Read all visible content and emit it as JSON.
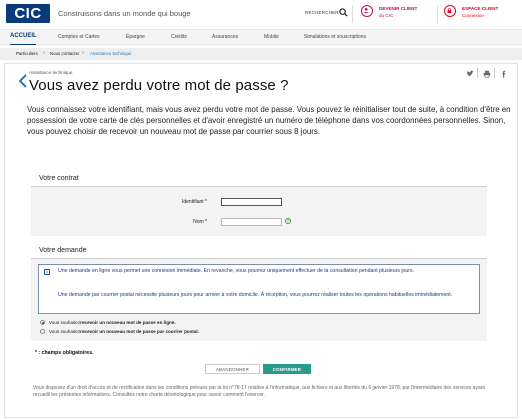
{
  "header": {
    "logo_text": "CIC",
    "tagline": "Construisons dans un monde qui bouge",
    "search_label": "RECHERCHER",
    "devenir_client": {
      "line1": "DEVENIR CLIENT",
      "line2": "du CIC"
    },
    "espace_client": {
      "line1": "ESPACE CLIENT",
      "line2": "Connexion"
    }
  },
  "nav": {
    "items": [
      "ACCUEIL",
      "Comptes et Cartes",
      "Épargne",
      "Crédits",
      "Assurances",
      "Mobile",
      "Simulations et souscriptions"
    ]
  },
  "breadcrumb": [
    "Particuliers",
    "Nous contacter",
    "Assistance technique"
  ],
  "page": {
    "kicker": "Assistance technique",
    "title": "Vous avez perdu votre mot de passe ?",
    "intro": "Vous connaissez votre identifiant, mais vous avez perdu votre mot de passe. Vous pouvez le réinitialiser tout de suite, à condition d'être en possession de votre carte de clés personnelles et d'avoir enregistré un numéro de téléphone dans vos coordonnées personnelles. Sinon, vous pouvez choisir de recevoir un nouveau mot de passe par courrier sous 8 jours."
  },
  "form": {
    "contrat_title": "Votre contrat",
    "identifiant_label": "Identifiant *",
    "identifiant_value": "",
    "nom_label": "Nom *",
    "nom_value": "",
    "demande_title": "Votre demande",
    "info_p1": "Une demande en ligne vous permet une connexion immédiate. En revanche, vous pourrez uniquement effectuer de la consultation pendant plusieurs jours.",
    "info_p2": "Une demande par courrier postal nécessite plusieurs jours pour arriver à votre domicile. À réception, vous pourrez réaliser toutes les opérations habituelles immédiatement.",
    "option1_prefix": "Vous souhaitez ",
    "option1_bold": "recevoir un nouveau mot de passe en ligne.",
    "option2_prefix": "Vous souhaitez ",
    "option2_bold": "recevoir un nouveau mot de passe par courrier postal.",
    "selected_option": 1,
    "mandatory_note": "* : champs obligatoires.",
    "cancel_label": "ABANDONNER",
    "confirm_label": "CONFIRMER"
  },
  "legal": "Vous disposez d'un droit d'accès et de rectification dans les conditions prévues par la loi n°78-17 relative à l'informatique, aux fichiers et aux libertés du 6 janvier 1978, par l'intermédiaire des services ayant recueilli les présentes informations. Consultez notre charte déontologique pour savoir comment l'exercer.",
  "colors": {
    "brand_blue": "#0a3a7a",
    "accent_red": "#e3001b",
    "magenta": "#b5105c",
    "confirm_teal": "#2a9a8a",
    "link_blue": "#2a7ab8"
  },
  "icons": [
    "search-icon",
    "user-plus-icon",
    "lock-icon",
    "twitter-icon",
    "print-icon",
    "facebook-icon",
    "back-arrow-icon",
    "help-icon",
    "info-icon"
  ]
}
